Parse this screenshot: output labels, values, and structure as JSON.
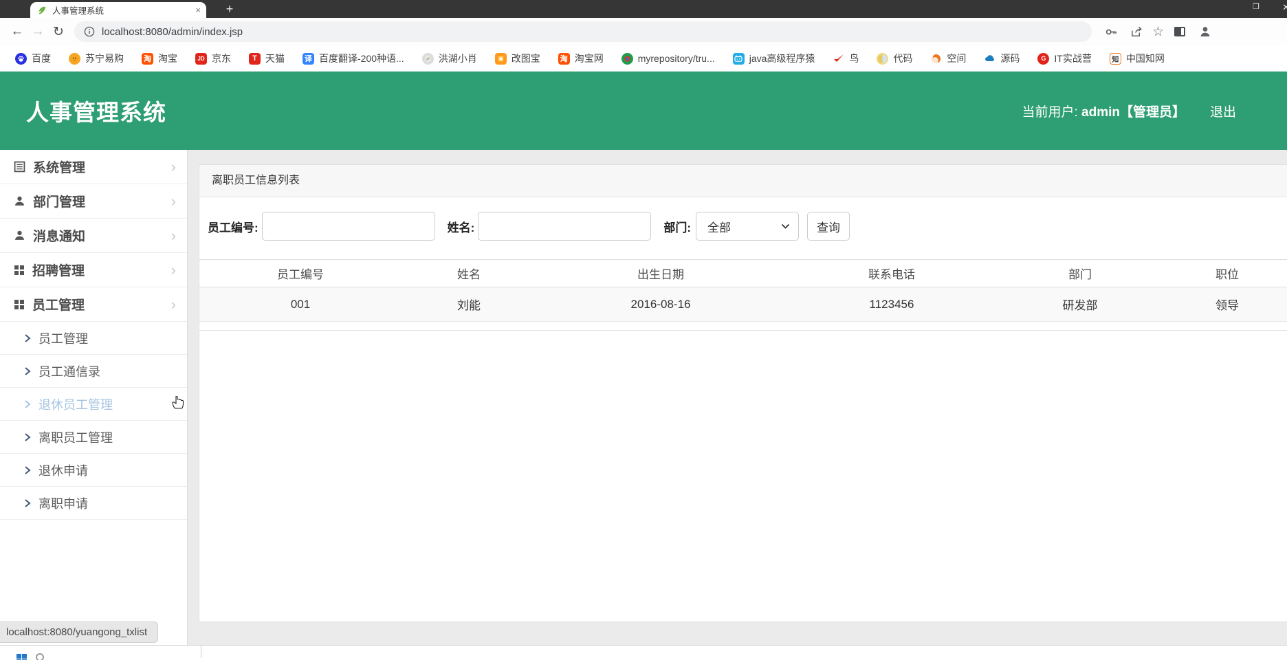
{
  "colors": {
    "header_green": "#2e9e74",
    "sidebar_hover_blue": "#a6c4e2",
    "tabbar_dark": "#363636"
  },
  "browser": {
    "tab_title": "人事管理系统",
    "tab_close": "×",
    "new_tab": "+",
    "url": "localhost:8080/admin/index.jsp",
    "bookmarks": [
      {
        "label": "百度"
      },
      {
        "label": "苏宁易购"
      },
      {
        "label": "淘宝"
      },
      {
        "label": "京东"
      },
      {
        "label": "天猫"
      },
      {
        "label": "百度翻译-200种语..."
      },
      {
        "label": "洪湖小肖"
      },
      {
        "label": "改图宝"
      },
      {
        "label": "淘宝网"
      },
      {
        "label": "myrepository/tru..."
      },
      {
        "label": "java高级程序猿"
      },
      {
        "label": "鸟"
      },
      {
        "label": "代码"
      },
      {
        "label": "空间"
      },
      {
        "label": "源码"
      },
      {
        "label": "IT实战营"
      },
      {
        "label": "中国知网"
      }
    ]
  },
  "header": {
    "title": "人事管理系统",
    "current_user_label": "当前用户:",
    "current_user_value": "admin【管理员】",
    "logout": "退出"
  },
  "sidebar": {
    "items": [
      {
        "label": "系统管理"
      },
      {
        "label": "部门管理"
      },
      {
        "label": "消息通知"
      },
      {
        "label": "招聘管理"
      },
      {
        "label": "员工管理"
      }
    ],
    "subitems": [
      {
        "label": "员工管理"
      },
      {
        "label": "员工通信录"
      },
      {
        "label": "退休员工管理"
      },
      {
        "label": "离职员工管理"
      },
      {
        "label": "退休申请"
      },
      {
        "label": "离职申请"
      }
    ]
  },
  "panel": {
    "title": "离职员工信息列表",
    "search": {
      "emp_no_label": "员工编号:",
      "name_label": "姓名:",
      "dept_label": "部门:",
      "dept_value": "全部",
      "query_button": "查询"
    },
    "table": {
      "headers": [
        "员工编号",
        "姓名",
        "出生日期",
        "联系电话",
        "部门",
        "职位"
      ],
      "rows": [
        [
          "001",
          "刘能",
          "2016-08-16",
          "1123456",
          "研发部",
          "领导"
        ]
      ]
    }
  },
  "statusbar": {
    "text": "localhost:8080/yuangong_txlist"
  }
}
